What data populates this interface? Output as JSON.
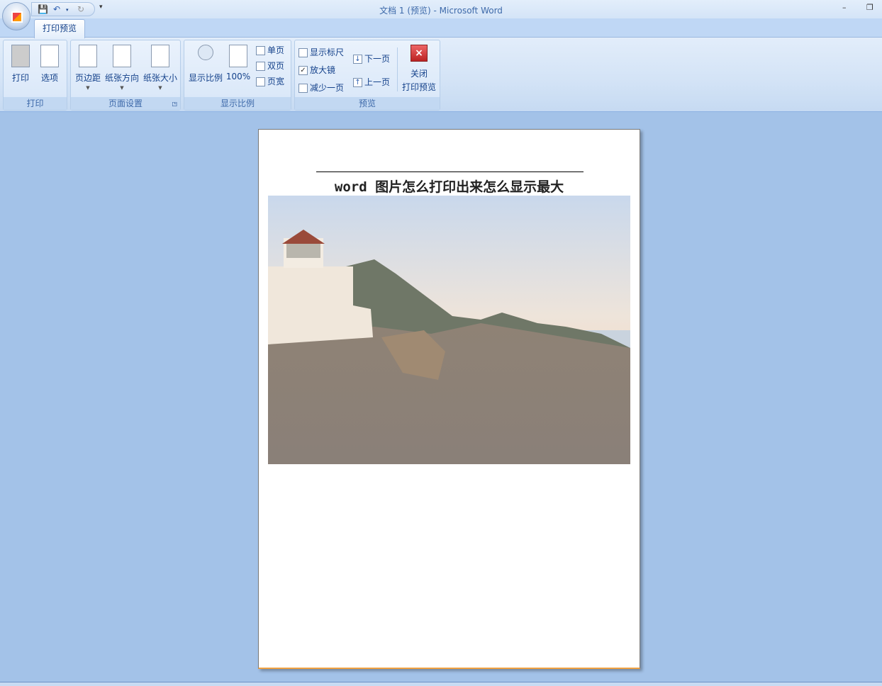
{
  "window": {
    "title": "文档 1 (预览) - Microsoft Word"
  },
  "tabs": [
    {
      "label": "打印预览"
    }
  ],
  "groups": {
    "print": {
      "label": "打印",
      "print": "打印",
      "options": "选项"
    },
    "page_setup": {
      "label": "页面设置",
      "margins": "页边距",
      "orientation": "纸张方向",
      "size": "纸张大小"
    },
    "zoom": {
      "label": "显示比例",
      "zoom": "显示比例",
      "hundred": "100%",
      "one_page": "单页",
      "two_pages": "双页",
      "page_width": "页宽"
    },
    "preview": {
      "label": "预览",
      "show_ruler": "显示标尺",
      "show_ruler_checked": false,
      "magnifier": "放大镜",
      "magnifier_checked": true,
      "shrink_one_page": "减少一页",
      "next_page": "下一页",
      "prev_page": "上一页",
      "close_line1": "关闭",
      "close_line2": "打印预览"
    }
  },
  "document": {
    "title": "word 图片怎么打印出来怎么显示最大"
  }
}
